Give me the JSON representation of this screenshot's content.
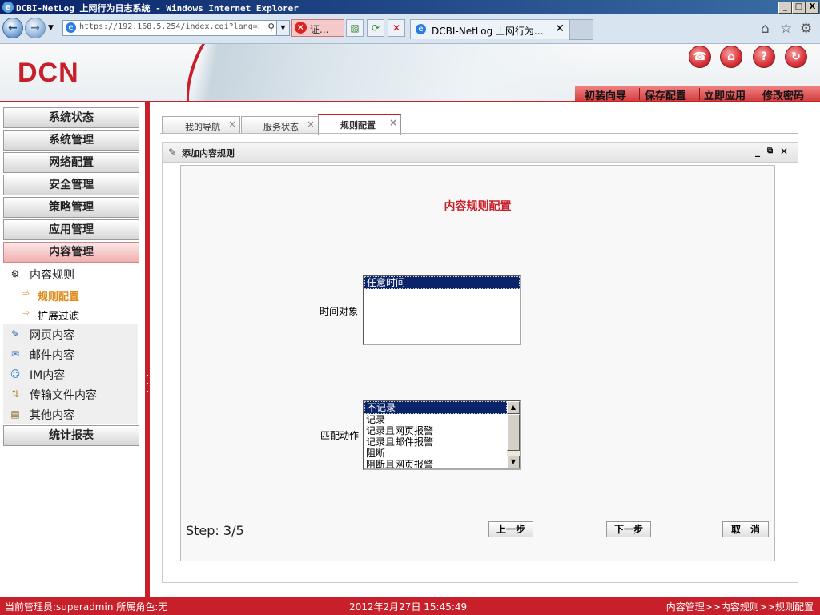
{
  "window": {
    "title": "DCBI-NetLog 上网行为日志系统 - Windows Internet Explorer",
    "buttons": {
      "minimize": "_",
      "maximize": "□",
      "close": "X"
    }
  },
  "browser": {
    "address": "https://192.168.5.254/index.cgi?lang=z",
    "cert_label": "证...",
    "tab_title": "DCBI-NetLog 上网行为...",
    "tab_close": "✕",
    "icons": [
      "back-icon",
      "forward-icon",
      "search-icon",
      "certificate-error-icon",
      "compatibility-icon",
      "refresh-icon",
      "stop-icon",
      "home-icon",
      "favorites-icon",
      "settings-icon"
    ]
  },
  "header": {
    "logo": "DCN",
    "menu": [
      "初装向导",
      "保存配置",
      "立即应用",
      "修改密码"
    ],
    "icon_colors": {
      "brand": "#c8202a"
    }
  },
  "sidebar": {
    "top_items": [
      "系统状态",
      "系统管理",
      "网络配置",
      "安全管理",
      "策略管理",
      "应用管理",
      "内容管理"
    ],
    "active_top": "内容管理",
    "sub_header": "内容规则",
    "sub_items": [
      "规则配置",
      "扩展过滤"
    ],
    "active_sub": "规则配置",
    "groups": [
      "网页内容",
      "邮件内容",
      "IM内容",
      "传输文件内容",
      "其他内容"
    ],
    "bottom_item": "统计报表"
  },
  "tabs": [
    {
      "label": "我的导航",
      "close": "×"
    },
    {
      "label": "服务状态",
      "close": "×"
    },
    {
      "label": "规则配置",
      "close": "×",
      "active": true
    }
  ],
  "panel": {
    "title": "添加内容规则",
    "controls": {
      "minimize": "_",
      "restore": "⧉",
      "close": "✕"
    },
    "form_title": "内容规则配置",
    "time_label": "时间对象",
    "time_options": [
      "任意时间"
    ],
    "time_selected": "任意时间",
    "action_label": "匹配动作",
    "action_options": [
      "不记录",
      "记录",
      "记录且网页报警",
      "记录且邮件报警",
      "阻断",
      "阻断且网页报警"
    ],
    "action_selected": "不记录",
    "step": "Step: 3/5",
    "prev": "上一步",
    "next": "下一步",
    "cancel": "取　消"
  },
  "status": {
    "admin": "当前管理员:superadmin  所属角色:无",
    "datetime": "2012年2月27日 15:45:49",
    "breadcrumb": "内容管理>>内容规则>>规则配置"
  }
}
